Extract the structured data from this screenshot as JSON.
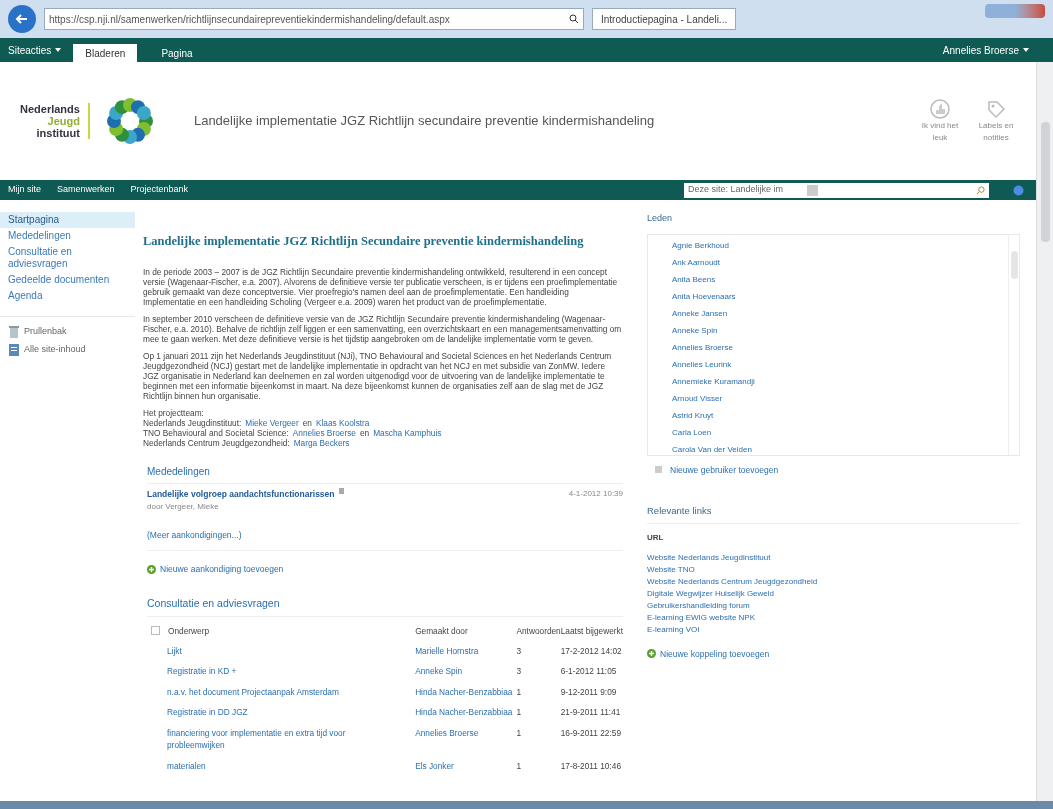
{
  "browser": {
    "address": "https://csp.nji.nl/samenwerken/richtlijnsecundairepreventiekindermishandeling/default.aspx",
    "tabs": [
      {
        "label": "Introductiepagina - Landeli...",
        "selected": true
      }
    ]
  },
  "ribbon": {
    "site_actions": "Siteacties",
    "tabs": [
      {
        "label": "Bladeren",
        "selected": true
      },
      {
        "label": "Pagina",
        "selected": false
      }
    ],
    "user": "Annelies Broerse"
  },
  "header": {
    "logo": [
      "Nederlands",
      "Jeugd",
      "instituut"
    ],
    "title": "Landelijke implementatie JGZ Richtlijn secundaire preventie kindermishandeling",
    "actions": [
      {
        "kind": "like",
        "label": "Ik vind het leuk"
      },
      {
        "kind": "tags",
        "label": "Labels en notities"
      }
    ]
  },
  "topnav": {
    "items": [
      "Mijn site",
      "Samenwerken",
      "Projectenbank"
    ],
    "scope": "Deze site: Landelijke im"
  },
  "quicklaunch": {
    "items": [
      {
        "label": "Startpagina",
        "selected": true
      },
      {
        "label": "Mededelingen",
        "selected": false
      },
      {
        "label": "Consultatie en adviesvragen",
        "selected": false
      },
      {
        "label": "Gedeelde documenten",
        "selected": false
      },
      {
        "label": "Agenda",
        "selected": false
      }
    ],
    "extras": [
      {
        "kind": "recycle",
        "label": "Prullenbak"
      },
      {
        "kind": "content",
        "label": "Alle site-inhoud"
      }
    ]
  },
  "main": {
    "title": "Landelijke implementatie JGZ Richtlijn Secundaire preventie kindermishandeling",
    "paragraphs": [
      "In de periode 2003 – 2007 is de JGZ Richtlijn Secundaire preventie kindermishandeling ontwikkeld, resulterend in een concept versie (Wagenaar-Fischer, e.a. 2007). Alvorens de definitieve versie ter publicatie verscheen, is er tijdens een proefimplementatie gebruik gemaakt van deze conceptversie. Vier proefregio's namen deel aan de proefimplementatie. Een handleiding Implementatie en een handleiding Scholing (Vergeer e.a. 2009) waren het product van de proefimplementatie.",
      "In september 2010 verscheen de definitieve versie van de JGZ Richtlijn Secundaire preventie kindermishandeling (Wagenaar-Fischer, e.a. 2010). Behalve de richtlijn zelf liggen er een samenvatting, een overzichtskaart en een managementsamenvatting om mee te gaan werken. Met deze definitieve versie is het tijdstip aangebroken om de landelijke implementatie vorm te geven.",
      "Op 1 januari 2011 zijn het Nederlands Jeugdinstituut (NJi), TNO Behavioural and Societal Sciences en het Nederlands Centrum Jeugdgezondheid (NCJ) gestart met de landelijke implementatie in opdracht van het NCJ en met subsidie van ZonMW. Iedere JGZ organisatie in Nederland kan deelnemen en zal worden uitgenodigd voor de uitvoering van de landelijke implementatie te beginnen met een informatie bijeenkomst in maart. Na deze bijeenkomst kunnen de organisaties zelf aan de slag met de JGZ Richtlijn binnen hun organisatie."
    ],
    "team_heading": "Het projectteam:",
    "team": [
      {
        "org": "Nederlands Jeugdinstituut:",
        "people": [
          "Mieke Vergeer",
          "Klaas Koolstra"
        ],
        "joiner": "en"
      },
      {
        "org": "TNO Behavioural and Societal Science:",
        "people": [
          "Annelies Broerse",
          "Mascha Kamphuis"
        ],
        "joiner": "en"
      },
      {
        "org": "Nederlands Centrum Jeugdgezondheid:",
        "people": [
          "Marga Beckers"
        ]
      }
    ]
  },
  "announcements": {
    "title": "Mededelingen",
    "items": [
      {
        "title": "Landelijke volgroep aandachtsfunctionarissen",
        "author": "door Vergeer, Mieke",
        "date": "4-1-2012 10:39",
        "new": true
      }
    ],
    "more": "(Meer aankondigingen...)",
    "add": "Nieuwe aankondiging toevoegen"
  },
  "discussions": {
    "title": "Consultatie en adviesvragen",
    "select_all_checked": false,
    "columns": [
      "Onderwerp",
      "Gemaakt door",
      "Antwoorden",
      "Laatst bijgewerkt"
    ],
    "rows": [
      {
        "subject": "Lijkt",
        "author": "Marielle Hornstra",
        "replies": "3",
        "updated": "17-2-2012 14:02"
      },
      {
        "subject": "Registratie in KD +",
        "author": "Anneke Spin",
        "replies": "3",
        "updated": "6-1-2012 11:05"
      },
      {
        "subject": "n.a.v. het document Projectaanpak Amsterdam",
        "author": "Hinda Nacher-Benzabbiaa",
        "replies": "1",
        "updated": "9-12-2011 9:09"
      },
      {
        "subject": "Registratie in DD JGZ",
        "author": "Hinda Nacher-Benzabbiaa",
        "replies": "1",
        "updated": "21-9-2011 11:41"
      },
      {
        "subject": "financiering voor implementatie en extra tijd voor probleemwijken",
        "author": "Annelies Broerse",
        "replies": "1",
        "updated": "16-9-2011 22:59"
      },
      {
        "subject": "materialen",
        "author": "Els Jonker",
        "replies": "1",
        "updated": "17-8-2011 10:46"
      }
    ]
  },
  "members": {
    "title": "Leden",
    "items": [
      "Agnie Berkhoud",
      "Ank Aarnoudt",
      "Anita Beens",
      "Anita Hoevenaars",
      "Anneke Jansen",
      "Anneke Spin",
      "Annelies Broerse",
      "Annelies Leurink",
      "Annemieke Kuramandji",
      "Arnoud Visser",
      "Astrid Kruyt",
      "Carla Loen",
      "Carola Van der Velden"
    ],
    "add": "Nieuwe gebruiker toevoegen"
  },
  "links": {
    "title": "Relevante links",
    "column": "URL",
    "items": [
      "Website Nederlands Jeugdinstituut",
      "Website TNO",
      "Website Nederlands Centrum Jeugdgezondheid",
      "Digitale Wegwijzer Huiselijk Geweld",
      "Gebruikershandleiding forum",
      "E-learning EWIG website NPK",
      "E-learning VOI"
    ],
    "add": "Nieuwe koppeling toevoegen"
  }
}
